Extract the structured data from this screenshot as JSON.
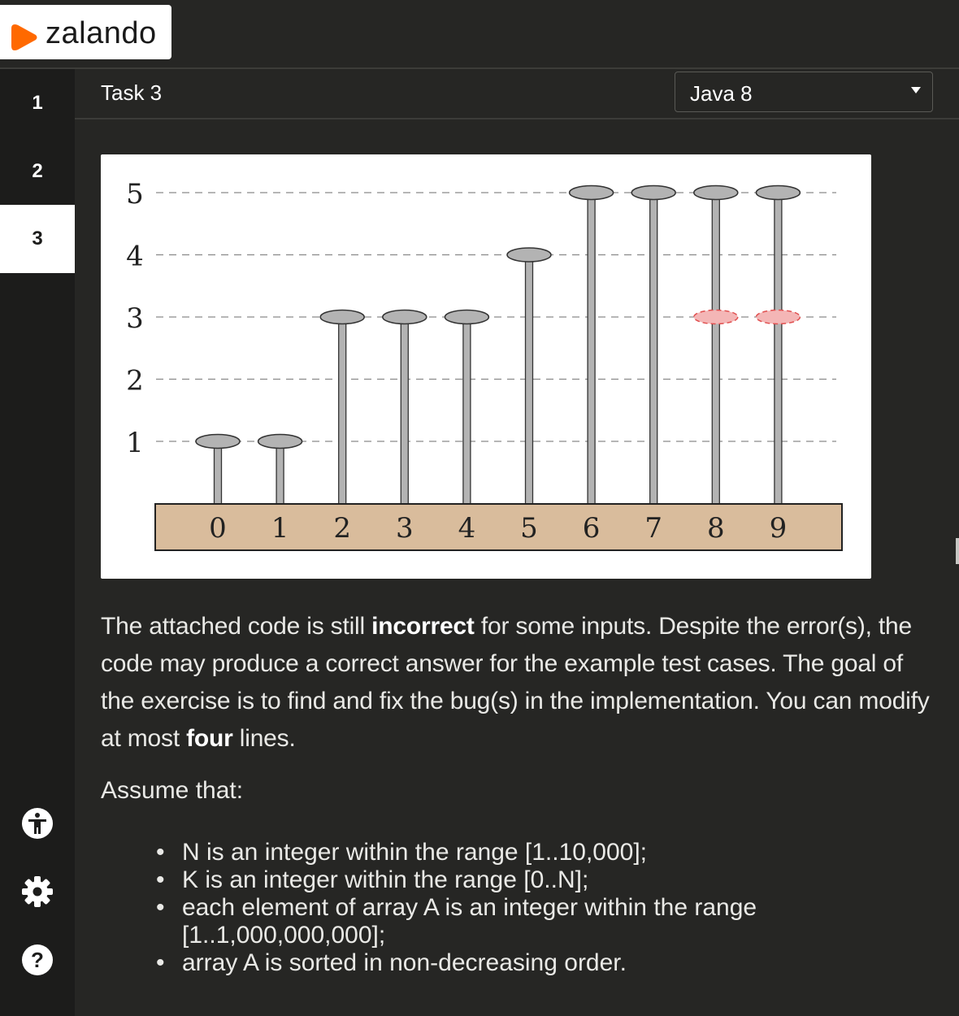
{
  "brand": {
    "name": "zalando",
    "accent": "#ff6900"
  },
  "sidebar": {
    "tasks": [
      {
        "label": "1",
        "active": false
      },
      {
        "label": "2",
        "active": false
      },
      {
        "label": "3",
        "active": true
      }
    ],
    "icons": [
      "accessibility-icon",
      "gear-icon",
      "help-icon"
    ]
  },
  "task": {
    "title": "Task 3",
    "language": "Java 8"
  },
  "figure": {
    "y_ticks": [
      "5",
      "4",
      "3",
      "2",
      "1"
    ],
    "base_labels": [
      "0",
      "1",
      "2",
      "3",
      "4",
      "5",
      "6",
      "7",
      "8",
      "9"
    ],
    "nail_heights": [
      1,
      1,
      3,
      3,
      3,
      4,
      5,
      5,
      5,
      5
    ],
    "highlight_level": 3,
    "highlighted_indices": [
      8,
      9
    ],
    "colors": {
      "nail": "#b3b3b3",
      "base": "#d9bc9c",
      "highlight": "#f4b6b6",
      "highlight_stroke": "#e05050"
    }
  },
  "description": {
    "p1_a": "The attached code is still ",
    "p1_b": "incorrect",
    "p1_c": " for some inputs. Despite the error(s), the code may produce a correct answer for the example test cases. The goal of the exercise is to find and fix the bug(s) in the implementation. You can modify at most ",
    "p1_d": "four",
    "p1_e": " lines.",
    "assume": "Assume that:",
    "bullets": [
      "N is an integer within the range [1..10,000];",
      "K is an integer within the range [0..N];",
      "each element of array A is an integer within the range [1..1,000,000,000];",
      "array A is sorted in non-decreasing order."
    ]
  }
}
